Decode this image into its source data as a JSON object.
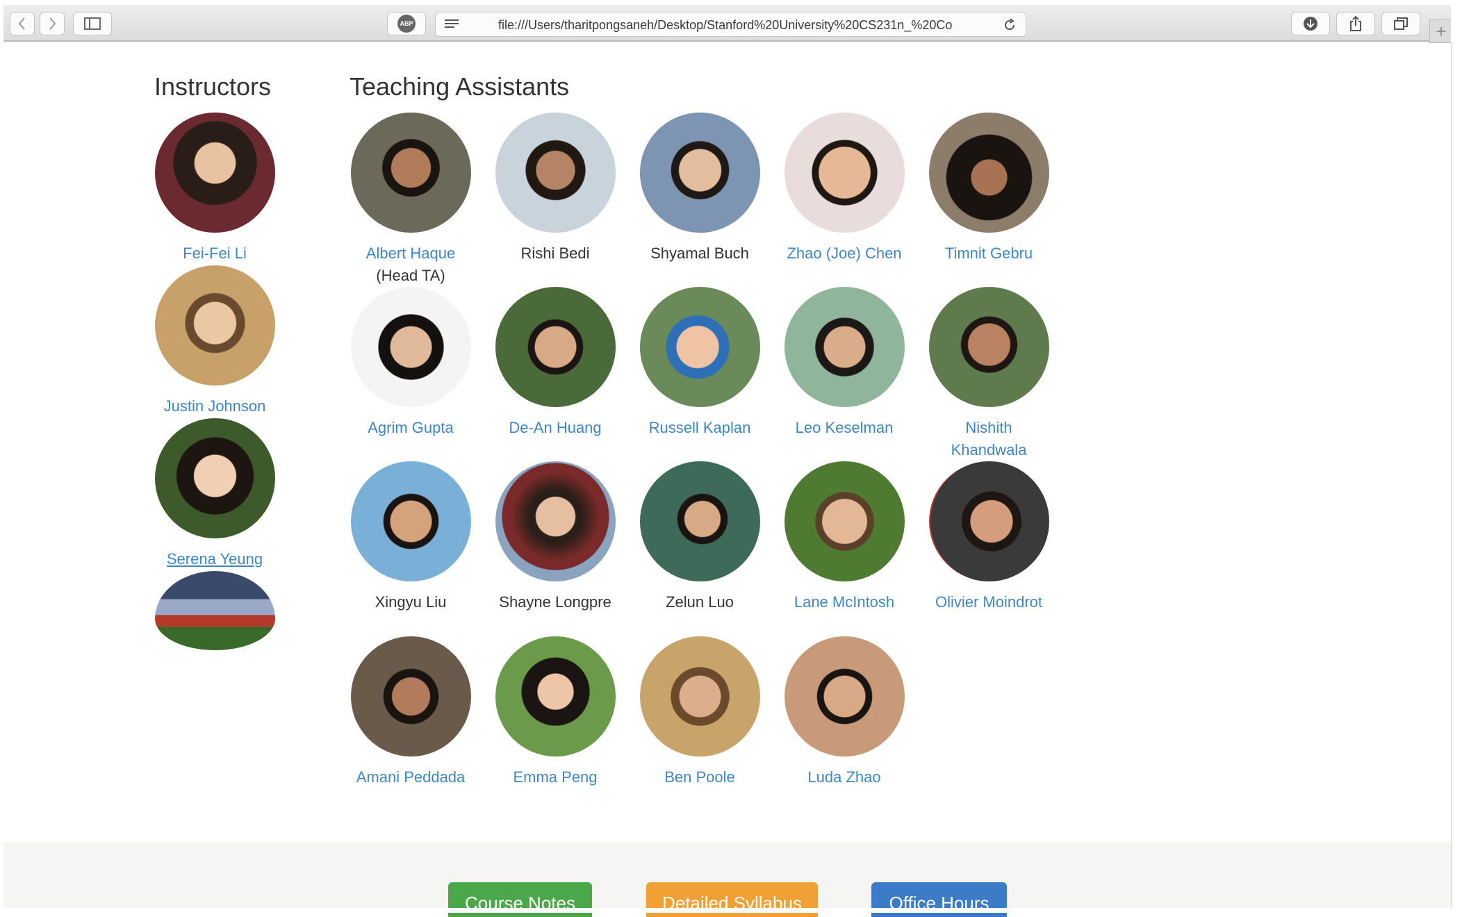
{
  "browser": {
    "url": "file:///Users/tharitpongsaneh/Desktop/Stanford%20University%20CS231n_%20Co",
    "adblock_label": "ABP"
  },
  "instructors": {
    "heading": "Instructors",
    "people": [
      {
        "name": "Fei-Fei Li"
      },
      {
        "name": "Justin Johnson"
      },
      {
        "name": "Serena Yeung"
      },
      {
        "name": ""
      }
    ]
  },
  "tas": {
    "heading": "Teaching Assistants",
    "people": [
      {
        "name": "Albert Haque",
        "subtitle": "(Head TA)"
      },
      {
        "name": "Rishi Bedi"
      },
      {
        "name": "Shyamal Buch"
      },
      {
        "name": "Zhao (Joe) Chen"
      },
      {
        "name": "Timnit Gebru"
      },
      {
        "name": "Agrim Gupta"
      },
      {
        "name": "De-An Huang"
      },
      {
        "name": "Russell Kaplan"
      },
      {
        "name": "Leo Keselman"
      },
      {
        "name": "Nishith Khandwala"
      },
      {
        "name": "Xingyu Liu"
      },
      {
        "name": "Shayne Longpre"
      },
      {
        "name": "Zelun Luo"
      },
      {
        "name": "Lane McIntosh"
      },
      {
        "name": "Olivier Moindrot"
      },
      {
        "name": "Amani Peddada"
      },
      {
        "name": "Emma Peng"
      },
      {
        "name": "Ben Poole"
      },
      {
        "name": "Luda Zhao"
      }
    ]
  },
  "footer": {
    "buttons": [
      {
        "label": "Course Notes",
        "color": "#4aa84a"
      },
      {
        "label": "Detailed Syllabus",
        "color": "#f0a035"
      },
      {
        "label": "Office Hours",
        "color": "#3b7bc8"
      }
    ]
  },
  "colors": {
    "link": "#3f86c5",
    "text": "#333333"
  }
}
